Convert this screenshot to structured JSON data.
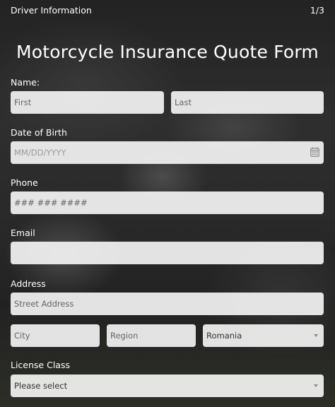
{
  "header": {
    "section_title": "Driver Information",
    "page_indicator": "1/3"
  },
  "form_title": "Motorcycle Insurance Quote Form",
  "name": {
    "label": "Name:",
    "first_placeholder": "First",
    "last_placeholder": "Last"
  },
  "dob": {
    "label": "Date of Birth",
    "mm": "MM",
    "dd": "DD",
    "yyyy": "YYYY",
    "sep": "/",
    "icon": "calendar-icon"
  },
  "phone": {
    "label": "Phone",
    "placeholder": "### ### ####"
  },
  "email": {
    "label": "Email",
    "placeholder": ""
  },
  "address": {
    "label": "Address",
    "street_placeholder": "Street Address",
    "city_placeholder": "City",
    "region_placeholder": "Region",
    "country_value": "Romania"
  },
  "license": {
    "label": "License Class",
    "placeholder": "Please select"
  }
}
